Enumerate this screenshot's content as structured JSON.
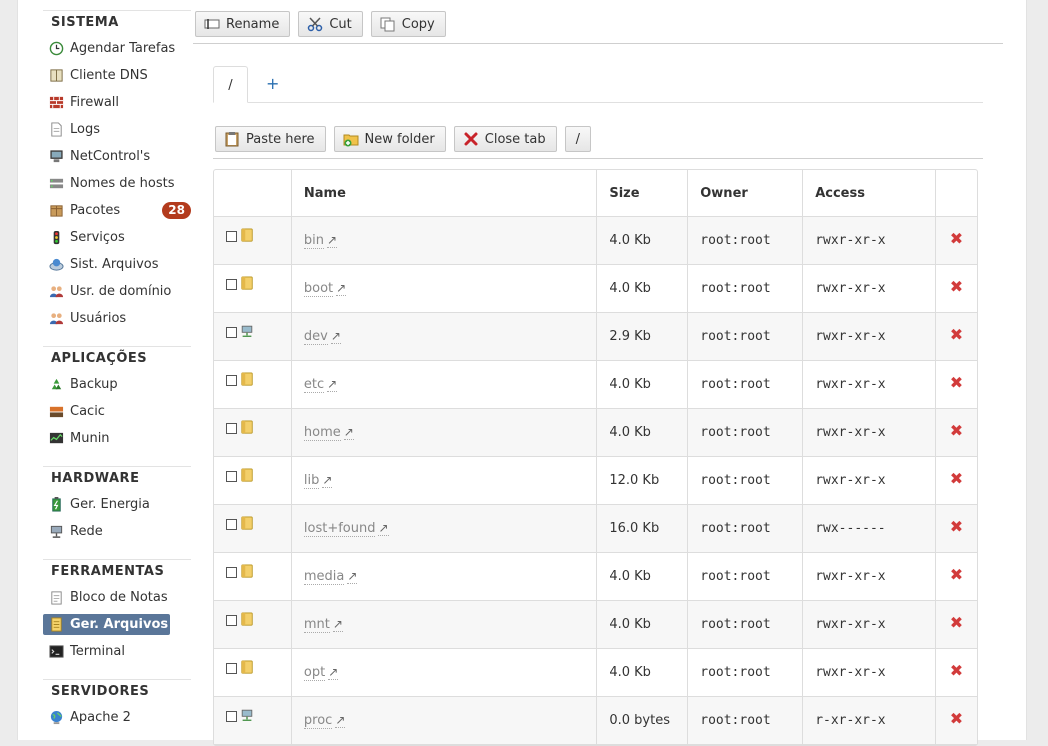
{
  "sidebar": {
    "sections": [
      {
        "header": "SISTEMA",
        "items": [
          {
            "label": "Agendar Tarefas",
            "icon": "clock-icon"
          },
          {
            "label": "Cliente DNS",
            "icon": "book-icon"
          },
          {
            "label": "Firewall",
            "icon": "brick-wall-icon"
          },
          {
            "label": "Logs",
            "icon": "document-icon"
          },
          {
            "label": "NetControl's",
            "icon": "computer-icon"
          },
          {
            "label": "Nomes de hosts",
            "icon": "hosts-icon"
          },
          {
            "label": "Pacotes",
            "icon": "package-icon",
            "badge": "28"
          },
          {
            "label": "Serviços",
            "icon": "traffic-light-icon"
          },
          {
            "label": "Sist. Arquivos",
            "icon": "drive-icon"
          },
          {
            "label": "Usr. de domínio",
            "icon": "users-icon"
          },
          {
            "label": "Usuários",
            "icon": "users-icon"
          }
        ]
      },
      {
        "header": "APLICAÇÕES",
        "items": [
          {
            "label": "Backup",
            "icon": "recycle-icon"
          },
          {
            "label": "Cacic",
            "icon": "cacic-icon"
          },
          {
            "label": "Munin",
            "icon": "monitor-graph-icon"
          }
        ]
      },
      {
        "header": "HARDWARE",
        "items": [
          {
            "label": "Ger. Energia",
            "icon": "battery-icon"
          },
          {
            "label": "Rede",
            "icon": "network-icon"
          }
        ]
      },
      {
        "header": "FERRAMENTAS",
        "items": [
          {
            "label": "Bloco de Notas",
            "icon": "notepad-icon"
          },
          {
            "label": "Ger. Arquivos",
            "icon": "file-manager-icon",
            "active": true
          },
          {
            "label": "Terminal",
            "icon": "terminal-icon"
          }
        ]
      },
      {
        "header": "SERVIDORES",
        "items": [
          {
            "label": "Apache 2",
            "icon": "globe-icon"
          }
        ]
      }
    ]
  },
  "toolbar": {
    "rename": "Rename",
    "cut": "Cut",
    "copy": "Copy"
  },
  "tabs": {
    "root": "/",
    "add": "+"
  },
  "toolbar2": {
    "paste": "Paste here",
    "new_folder": "New folder",
    "close_tab": "Close tab",
    "path": "/"
  },
  "table": {
    "headers": {
      "name": "Name",
      "size": "Size",
      "owner": "Owner",
      "access": "Access"
    },
    "rows": [
      {
        "name": "bin",
        "size": "4.0 Kb",
        "owner": "root:root",
        "access": "rwxr-xr-x",
        "type": "folder"
      },
      {
        "name": "boot",
        "size": "4.0 Kb",
        "owner": "root:root",
        "access": "rwxr-xr-x",
        "type": "folder"
      },
      {
        "name": "dev",
        "size": "2.9 Kb",
        "owner": "root:root",
        "access": "rwxr-xr-x",
        "type": "device"
      },
      {
        "name": "etc",
        "size": "4.0 Kb",
        "owner": "root:root",
        "access": "rwxr-xr-x",
        "type": "folder"
      },
      {
        "name": "home",
        "size": "4.0 Kb",
        "owner": "root:root",
        "access": "rwxr-xr-x",
        "type": "folder"
      },
      {
        "name": "lib",
        "size": "12.0 Kb",
        "owner": "root:root",
        "access": "rwxr-xr-x",
        "type": "folder"
      },
      {
        "name": "lost+found",
        "size": "16.0 Kb",
        "owner": "root:root",
        "access": "rwx------",
        "type": "folder"
      },
      {
        "name": "media",
        "size": "4.0 Kb",
        "owner": "root:root",
        "access": "rwxr-xr-x",
        "type": "folder"
      },
      {
        "name": "mnt",
        "size": "4.0 Kb",
        "owner": "root:root",
        "access": "rwxr-xr-x",
        "type": "folder"
      },
      {
        "name": "opt",
        "size": "4.0 Kb",
        "owner": "root:root",
        "access": "rwxr-xr-x",
        "type": "folder"
      },
      {
        "name": "proc",
        "size": "0.0 bytes",
        "owner": "root:root",
        "access": "r-xr-xr-x",
        "type": "device"
      }
    ],
    "link_glyph": "↗",
    "delete_glyph": "✖"
  },
  "colors": {
    "accent": "#5a7699",
    "badge": "#b33b1d",
    "delete": "#d23b3b",
    "link": "#2a6fb0"
  }
}
